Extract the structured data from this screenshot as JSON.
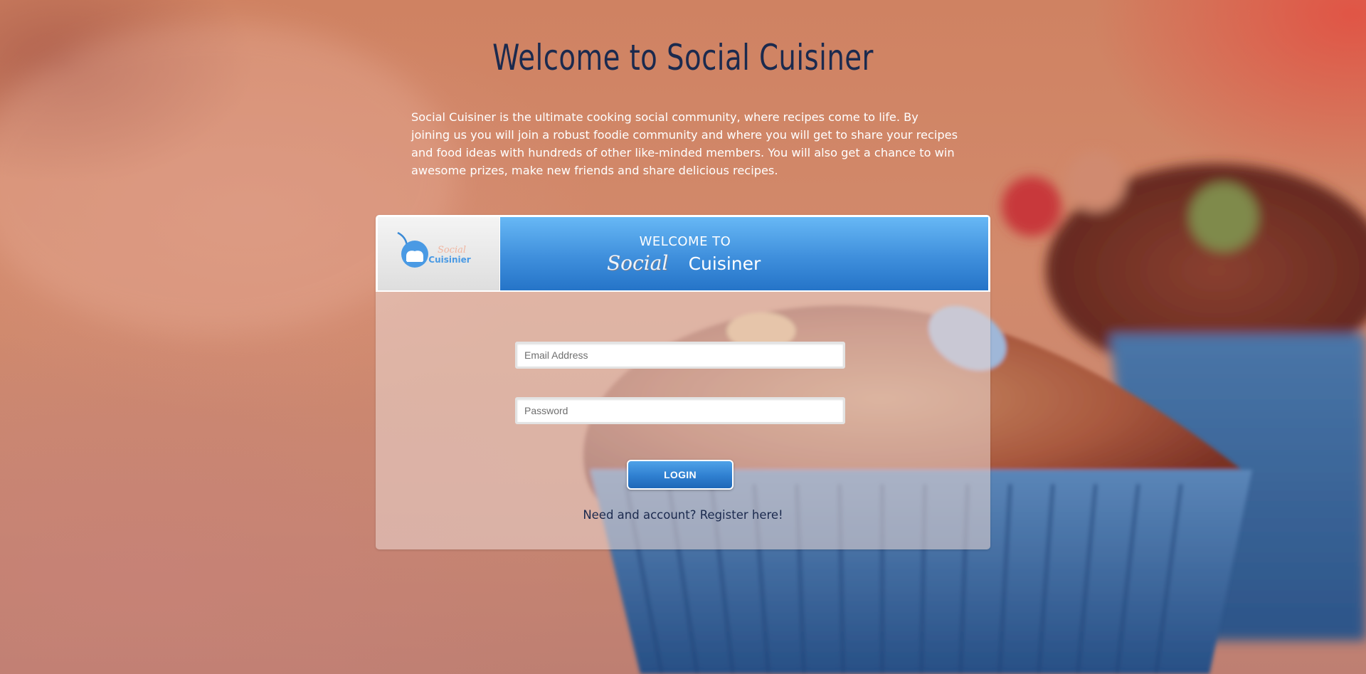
{
  "page": {
    "heading": "Welcome to Social Cuisiner",
    "intro": "Social Cuisiner is the ultimate cooking social community, where recipes come to life. By joining us you will join a robust foodie community and where you will get to share your recipes and food ideas with hundreds of other like-minded members. You will also get a chance to win awesome prizes, make new friends and share delicious recipes."
  },
  "card": {
    "logo": {
      "line1": "Social",
      "line2": "Cuisinier"
    },
    "banner": {
      "welcome": "WELCOME TO",
      "social": "Social",
      "cuisiner": "Cuisiner"
    },
    "form": {
      "email_placeholder": "Email Address",
      "password_placeholder": "Password",
      "login_label": "LOGIN",
      "register_link": "Need and account? Register here!"
    }
  },
  "colors": {
    "heading": "#1b2a4e",
    "banner_blue": "#3f8fdc",
    "button_blue": "#2f7fd0",
    "cupcake_liner": "#3d6fa6"
  }
}
